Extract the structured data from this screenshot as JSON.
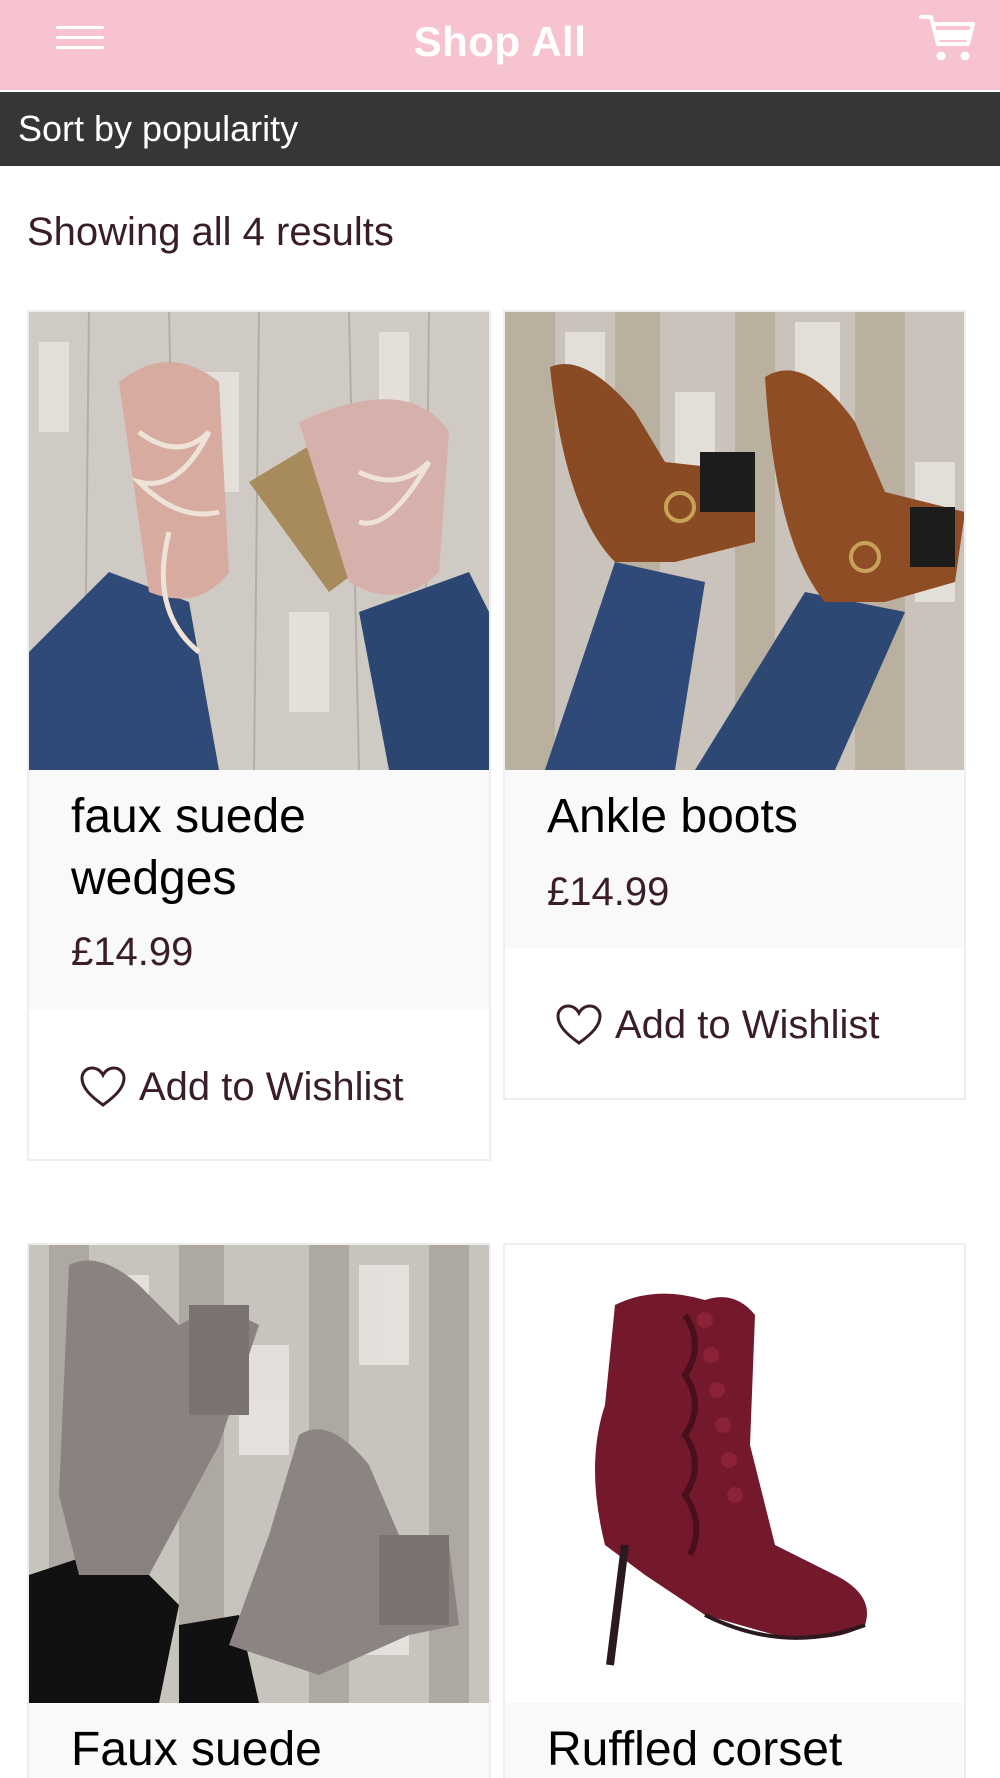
{
  "header": {
    "menu_icon": "hamburger-menu-icon",
    "title": "Shop All",
    "cart_icon": "shopping-cart-icon"
  },
  "sort": {
    "label": "Sort by popularity"
  },
  "results": {
    "count_text": "Showing all 4 results"
  },
  "products": [
    {
      "title": "faux suede wedges",
      "price": "£14.99",
      "wishlist_label": "Add to Wishlist",
      "image": "pink lace-up faux suede cork wedge sandals"
    },
    {
      "title": "Ankle boots",
      "price": "£14.99",
      "wishlist_label": "Add to Wishlist",
      "image": "tan buckle strap heeled ankle boots"
    },
    {
      "title": "Faux suede",
      "image": "grey faux suede block heel ankle boots"
    },
    {
      "title": "Ruffled corset",
      "image": "burgundy satin ruffled lace-up stiletto boot"
    }
  ],
  "colors": {
    "header_bg": "#f6c3cf",
    "sort_bar_bg": "#363636",
    "text_dark": "#3a1d2b"
  }
}
